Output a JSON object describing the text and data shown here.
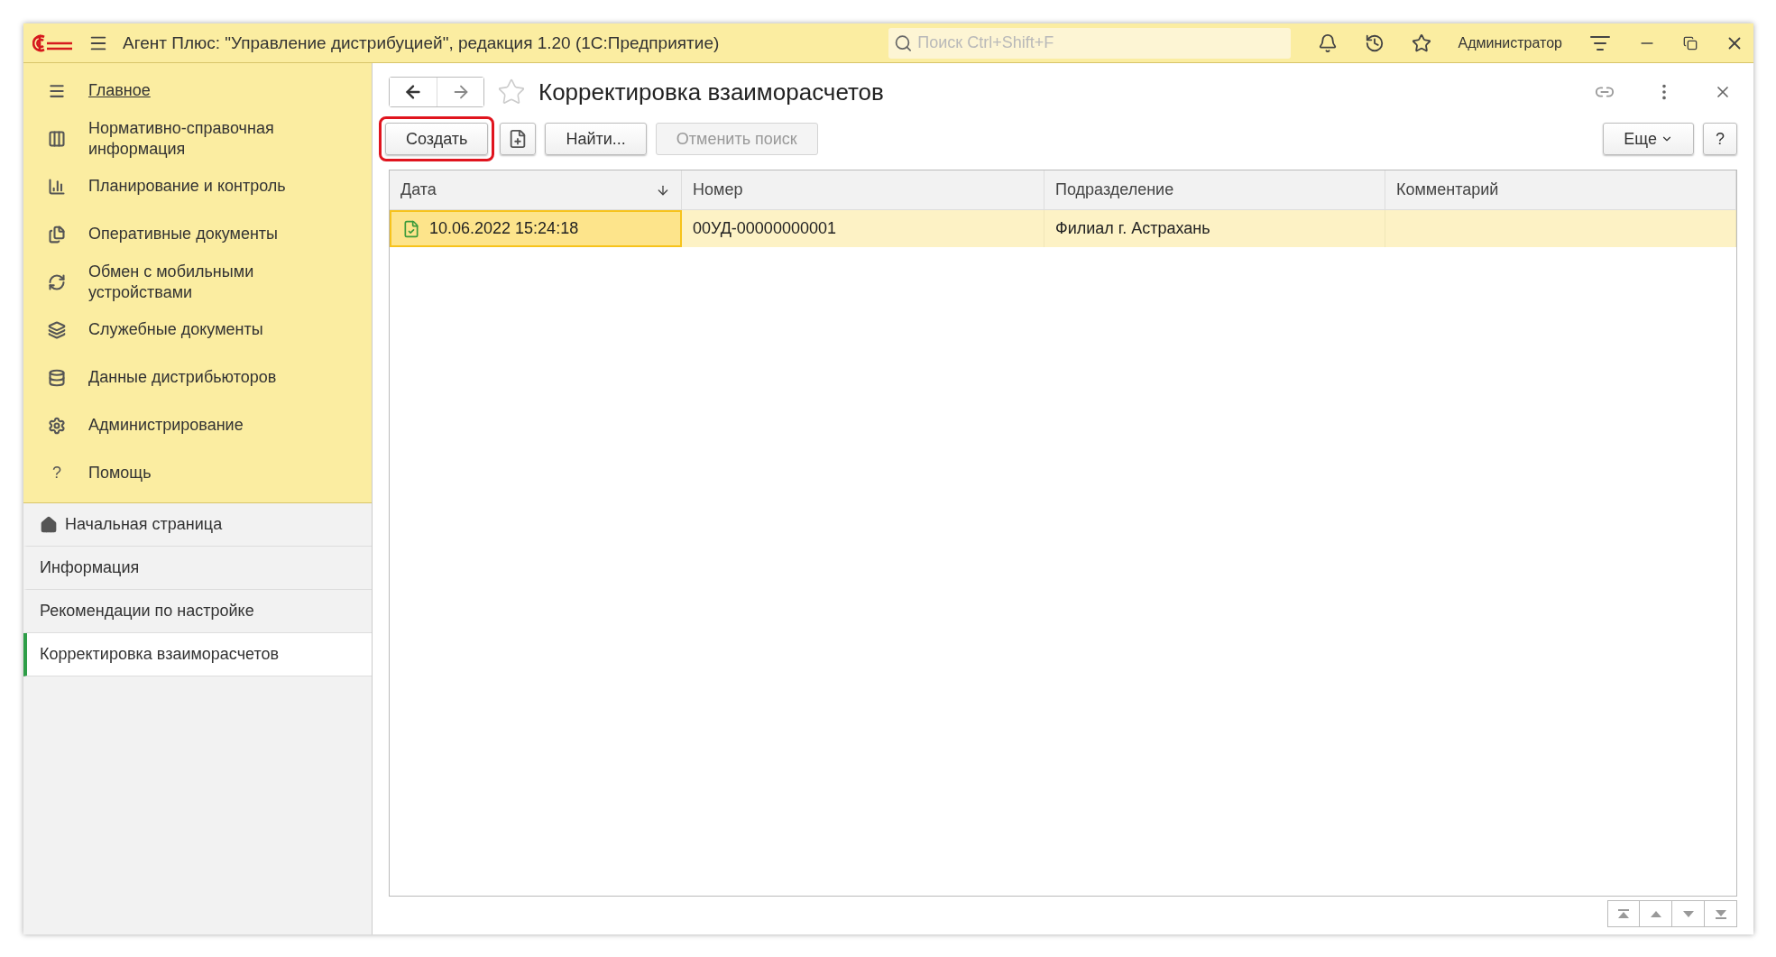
{
  "window": {
    "title": "Агент Плюс: \"Управление дистрибуцией\", редакция 1.20  (1С:Предприятие)",
    "search_placeholder": "Поиск Ctrl+Shift+F",
    "user": "Администратор"
  },
  "sections": [
    {
      "label": "Главное",
      "selected": true
    },
    {
      "label": "Нормативно-справочная информация",
      "selected": false
    },
    {
      "label": "Планирование и контроль",
      "selected": false
    },
    {
      "label": "Оперативные документы",
      "selected": false
    },
    {
      "label": "Обмен с мобильными устройствами",
      "selected": false
    },
    {
      "label": "Служебные документы",
      "selected": false
    },
    {
      "label": "Данные дистрибьюторов",
      "selected": false
    },
    {
      "label": "Администрирование",
      "selected": false
    },
    {
      "label": "Помощь",
      "selected": false
    }
  ],
  "help_glyph": "?",
  "open_pages": [
    {
      "label": "Начальная страница",
      "selected": false,
      "kind": "home"
    },
    {
      "label": "Информация",
      "selected": false,
      "kind": "page"
    },
    {
      "label": "Рекомендации по настройке",
      "selected": false,
      "kind": "page"
    },
    {
      "label": "Корректировка взаиморасчетов",
      "selected": true,
      "kind": "page"
    }
  ],
  "form": {
    "title": "Корректировка взаиморасчетов",
    "favorite": false,
    "buttons": [
      {
        "kind": "text",
        "label": "Создать",
        "highlighted": true,
        "disabled": false
      },
      {
        "kind": "copy",
        "highlighted": false,
        "disabled": false
      },
      {
        "kind": "text",
        "label": "Найти...",
        "highlighted": false,
        "disabled": false
      },
      {
        "kind": "text",
        "label": "Отменить поиск",
        "highlighted": false,
        "disabled": true
      }
    ],
    "more": "Еще",
    "help": "?"
  },
  "table": {
    "columns": [
      {
        "label": "Дата",
        "sorted": true
      },
      {
        "label": "Номер",
        "sorted": false
      },
      {
        "label": "Подразделение",
        "sorted": false
      },
      {
        "label": "Комментарий",
        "sorted": false
      }
    ],
    "rows": [
      {
        "selected": true,
        "posted": true,
        "cells": [
          "10.06.2022 15:24:18",
          "00УД-00000000001",
          "Филиал г. Астрахань",
          ""
        ]
      }
    ]
  }
}
